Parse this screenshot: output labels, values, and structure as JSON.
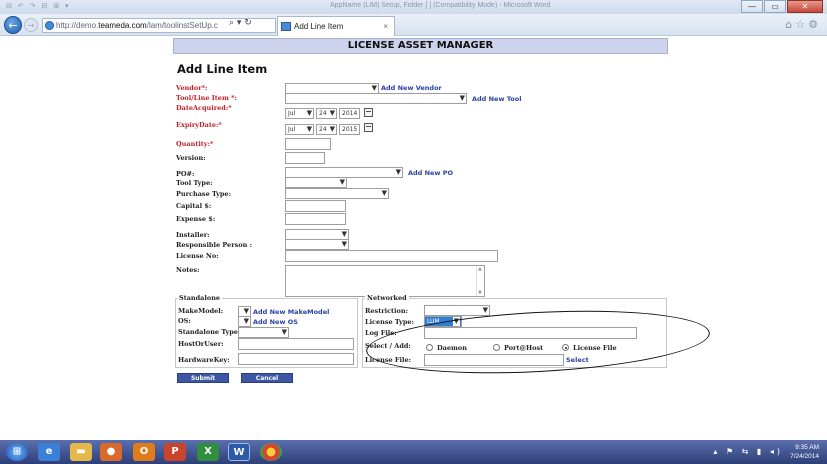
{
  "browser": {
    "window_title": "AppName (LIM) Setup, Folder [ ] (Compatibility Mode) - Microsoft Word",
    "quick_access": "⊟ ↶ ↷ ⊟ ⊞ ▾",
    "address_prefix": "http://demo.",
    "address_host": "teameda.com",
    "address_path": "/lam/toolinstSetUp.c",
    "address_tools": "⌕ ▾ ↻",
    "tab_title": "Add Line Item",
    "tab_close": "×",
    "back_icon": "←",
    "forward_icon": "→",
    "right_tools": "⌂☆⚙",
    "window_buttons": [
      "—",
      "▭",
      "✕"
    ]
  },
  "page": {
    "banner": "LICENSE ASSET MANAGER",
    "title": "Add Line Item"
  },
  "form": {
    "vendor_label": "Vendor*:",
    "add_vendor": "Add New Vendor",
    "tool_label": "Tool/Line Item *:",
    "add_tool": "Add New Tool",
    "date_acquired_label": "DateAcquired:*",
    "date_acquired": {
      "month": "Jul",
      "day": "24",
      "year": "2014"
    },
    "expiry_label": "ExpiryDate:*",
    "expiry": {
      "month": "Jul",
      "day": "24",
      "year": "2015"
    },
    "quantity_label": "Quantity:*",
    "version_label": "Version:",
    "po_label": "PO#:",
    "add_po": "Add New PO",
    "tool_type_label": "Tool Type:",
    "purchase_type_label": "Purchase Type:",
    "capital_label": "Capital $:",
    "expense_label": "Expense $:",
    "installer_label": "Installer:",
    "responsible_label": "Responsible Person :",
    "license_no_label": "License No:",
    "notes_label": "Notes:"
  },
  "standalone": {
    "legend": "Standalone",
    "makemodel_label": "MakeModel:",
    "add_makemodel": "Add New MakeModel",
    "os_label": "OS:",
    "add_os": "Add New OS",
    "type_label": "Standalone Type:",
    "host_label": "HostOrUser:",
    "hardware_label": "HardwareKey:"
  },
  "networked": {
    "legend": "Networked",
    "restriction_label": "Restriction:",
    "license_type_label": "License Type:",
    "license_type_value": "LUM",
    "log_file_label": "Log File:",
    "select_add_label": "Select / Add:",
    "radio_daemon": "Daemon",
    "radio_porthost": "Port@Host",
    "radio_license_file": "License File",
    "license_file_label": "License File:",
    "select_link": "Select"
  },
  "buttons": {
    "submit": "Submit",
    "cancel": "Cancel"
  },
  "taskbar": {
    "time": "9:35 AM",
    "date": "7/24/2014",
    "tray_icons": "▴ ⚑ ⇆ ▮ ◂)"
  }
}
